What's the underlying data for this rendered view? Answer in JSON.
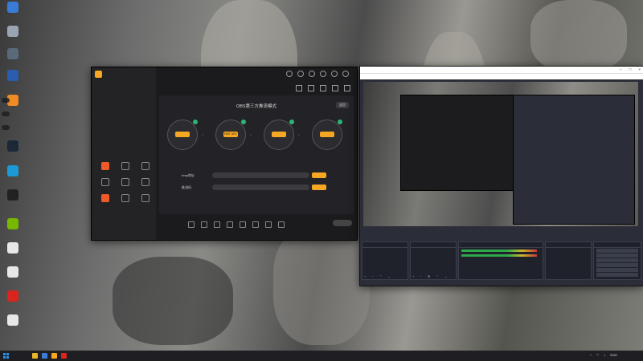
{
  "desktop": {
    "icons": [
      {
        "label": "",
        "color": "#3a7bd5"
      },
      {
        "label": "",
        "color": "#9aa5b1"
      },
      {
        "label": "",
        "color": "#5a6a7a"
      },
      {
        "label": "",
        "color": "#2a5db0"
      },
      {
        "label": "",
        "color": "#f08a24"
      },
      {
        "label": "",
        "color": "#1b2838"
      },
      {
        "label": "",
        "color": "#1b9ad6"
      },
      {
        "label": "",
        "color": "#222222"
      },
      {
        "label": "",
        "color": "#76b900"
      },
      {
        "label": "",
        "color": "#e8e8e8"
      },
      {
        "label": "",
        "color": "#e8e8e8"
      },
      {
        "label": "",
        "color": "#d9251d"
      },
      {
        "label": "",
        "color": "#e8e8e8"
      }
    ],
    "notifications": [
      "",
      "",
      ""
    ]
  },
  "stream_app": {
    "version_badge": "",
    "sidebar_tabs": [
      "",
      "",
      ""
    ],
    "empty_hint": "",
    "tools_heading": "",
    "tools": [
      {
        "label": "",
        "active": true
      },
      {
        "label": "",
        "active": false
      },
      {
        "label": "",
        "active": false
      },
      {
        "label": "",
        "active": false
      },
      {
        "label": "",
        "active": false
      },
      {
        "label": "",
        "active": false
      },
      {
        "label": "",
        "active": true
      },
      {
        "label": "",
        "active": false
      },
      {
        "label": "",
        "active": false
      }
    ],
    "footer": "",
    "room_title": "",
    "room_tag": "",
    "meta": [
      "",
      "",
      ""
    ],
    "card_title": "OBS第三方推流模式",
    "back_button": "返回",
    "steps": [
      {
        "pill": "",
        "caption": "",
        "done": true
      },
      {
        "pill": "RMT URL",
        "caption": "",
        "done": true
      },
      {
        "pill": "",
        "caption": "",
        "done": true
      },
      {
        "pill": "",
        "caption": "",
        "done": true
      }
    ],
    "fields": [
      {
        "label": "rtmp地址",
        "placeholder": "",
        "button": ""
      },
      {
        "label": "推流码",
        "placeholder": "",
        "button": ""
      }
    ],
    "hint": "",
    "bottom_bar": [
      "",
      "",
      "",
      "",
      "",
      "",
      "",
      ""
    ],
    "go_live": "",
    "status": ""
  },
  "obs": {
    "title": "",
    "menu": [
      "",
      "",
      "",
      "",
      "",
      "",
      ""
    ],
    "dock_tabs": [
      "",
      ""
    ],
    "scenes_header": "",
    "scenes": [
      ""
    ],
    "sources_header": "",
    "sources": [
      ""
    ],
    "mixer_header": "",
    "mixer_rows": [
      "",
      ""
    ],
    "transitions_header": "",
    "transition_value": "",
    "controls_header": "",
    "controls": [
      "",
      "",
      "",
      "",
      "",
      ""
    ],
    "status": ""
  },
  "taskbar": {
    "apps": [
      "#e8b62a",
      "#3a7bd5",
      "#f5a623",
      "#d9251d"
    ],
    "tray": [
      "ENG"
    ],
    "time": "",
    "date": ""
  }
}
